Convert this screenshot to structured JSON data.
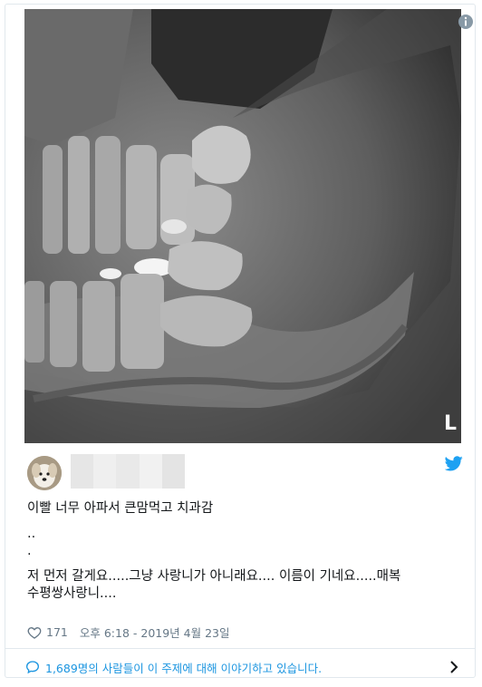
{
  "media": {
    "image_name": "panoramic-dental-xray",
    "side_marker": "L",
    "info_icon": "info-icon"
  },
  "author": {
    "avatar_icon": "dog-avatar",
    "name_blurred": true
  },
  "brand": {
    "icon": "twitter-bird-icon",
    "color": "#1da1f2"
  },
  "tweet": {
    "line1": "이빨 너무 아파서 큰맘먹고 치과감",
    "line2": "..",
    "line3": ".",
    "line4": "저 먼저 갈게요.....그냥 사랑니가 아니래요.... 이름이 기네요.....매복",
    "line5": "수평쌍사랑니...."
  },
  "meta": {
    "heart_icon": "heart-icon",
    "likes": "171",
    "timestamp": "오후 6:18 - 2019년 4월 23일"
  },
  "conversation": {
    "icon": "speech-bubble-icon",
    "label": "1,689명의 사람들이 이 주제에 대해 이야기하고 있습니다.",
    "chevron_icon": "chevron-right-icon",
    "color": "#1b95e0"
  }
}
